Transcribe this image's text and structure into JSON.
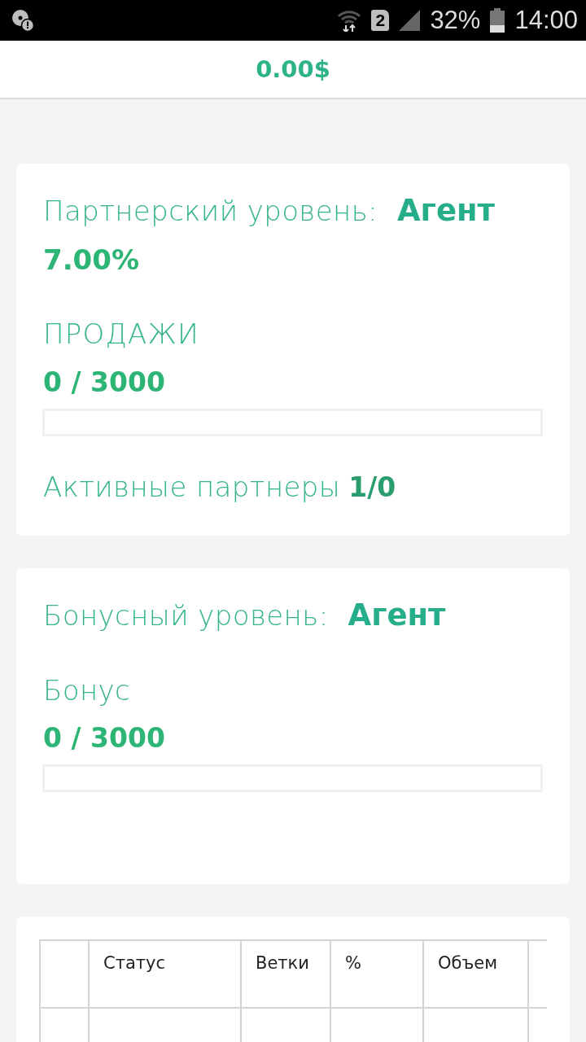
{
  "status_bar": {
    "sim_label": "2",
    "battery_text": "32%",
    "time": "14:00"
  },
  "header": {
    "balance": "0.00$"
  },
  "partner_card": {
    "label": "Партнерский уровень:",
    "level_name": "Агент",
    "percent": "7.00%",
    "sales_label": "ПРОДАЖИ",
    "sales_value": "0 / 3000",
    "sales_progress": {
      "level": 0
    },
    "active_label": "Активные партнеры",
    "active_value": "1/0"
  },
  "bonus_card": {
    "label": "Бонусный уровень:",
    "level_name": "Агент",
    "bonus_label": "Бонус",
    "bonus_value": "0 / 3000",
    "bonus_progress": {
      "level": 0
    }
  },
  "table": {
    "columns": [
      "Статус",
      "Ветки",
      "%",
      "Объем"
    ]
  }
}
